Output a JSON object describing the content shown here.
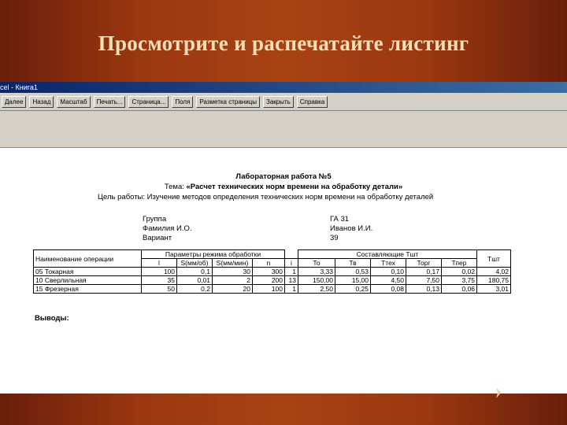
{
  "slide": {
    "title": "Просмотрите и распечатайте листинг"
  },
  "window": {
    "title": "cel - Книга1"
  },
  "toolbar": {
    "buttons": [
      "Далее",
      "Назад",
      "Масштаб",
      "Печать...",
      "Страница...",
      "Поля",
      "Разметка страницы",
      "Закрыть",
      "Справка"
    ]
  },
  "doc": {
    "lab_title": "Лабораторная работа №5",
    "theme_label": "Тема: ",
    "theme_text": "«Расчет технических норм времени на обработку детали»",
    "goal": "Цель работы: Изучение методов определения технических норм времени на обработку деталей",
    "group_label": "Группа",
    "name_label": "Фамилия И.О.",
    "variant_label": "Вариант",
    "group_value": "ГА 31",
    "name_value": "Иванов И.И.",
    "variant_value": "39",
    "conclusions": "Выводы:"
  },
  "table": {
    "op_header": "Наименование операции",
    "params_header": "Параметры режима обработки",
    "comp_header": "Составляющие Тшт",
    "tsht_header": "Тшт",
    "param_cols": [
      "l",
      "S(мм/об)",
      "S(мм/мин)",
      "n",
      "i"
    ],
    "comp_cols": [
      "То",
      "Тв",
      "Ттех",
      "Торг",
      "Тпер"
    ],
    "rows": [
      {
        "op": "05 Токарная",
        "vals": [
          "100",
          "0,1",
          "30",
          "300",
          "1",
          "3,33",
          "0,53",
          "0,10",
          "0,17",
          "0,02",
          "4,02"
        ]
      },
      {
        "op": "10 Сверлильная",
        "vals": [
          "35",
          "0,01",
          "2",
          "200",
          "13",
          "150,00",
          "15,00",
          "4,50",
          "7,50",
          "3,75",
          "180,75"
        ]
      },
      {
        "op": "15 Фрезерная",
        "vals": [
          "50",
          "0,2",
          "20",
          "100",
          "1",
          "2,50",
          "0,25",
          "0,08",
          "0,13",
          "0,06",
          "3,01"
        ]
      }
    ]
  }
}
